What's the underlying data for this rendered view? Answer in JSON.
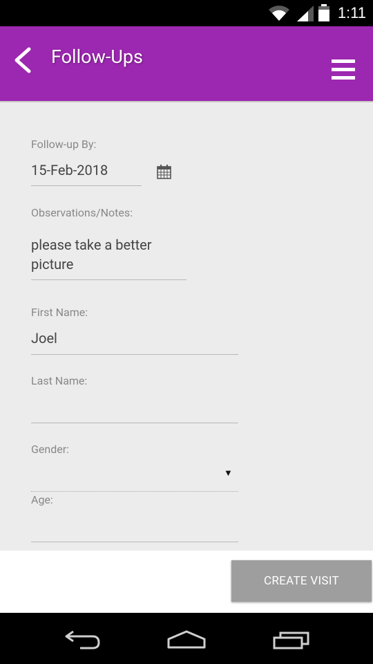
{
  "status_bar": {
    "time": "1:11"
  },
  "app_bar": {
    "title": "Follow-Ups"
  },
  "form": {
    "followup_label": "Follow-up By:",
    "followup_value": "15-Feb-2018",
    "notes_label": "Observations/Notes:",
    "notes_line1": "please take a better",
    "notes_line2": "picture",
    "first_name_label": "First Name:",
    "first_name_value": "Joel",
    "last_name_label": "Last Name:",
    "last_name_value": "",
    "gender_label": "Gender:",
    "gender_value": "",
    "age_label": "Age:",
    "age_value": ""
  },
  "actions": {
    "create_visit": "CREATE VISIT"
  },
  "colors": {
    "appbar": "#9c27b0",
    "button": "#9e9e9e"
  }
}
